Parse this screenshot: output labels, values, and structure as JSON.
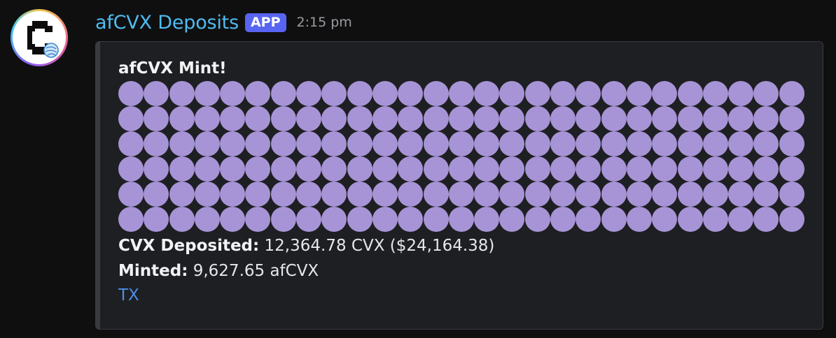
{
  "message": {
    "username": "afCVX Deposits",
    "badge": "APP",
    "timestamp": "2:15 pm",
    "avatar_icon": "clever-c-logo-icon"
  },
  "embed": {
    "title": "afCVX Mint!",
    "dot_count": 162,
    "dot_color": "#a794d6",
    "fields": [
      {
        "label": "CVX Deposited:",
        "value": "12,364.78 CVX ($24,164.38)"
      },
      {
        "label": "Minted:",
        "value": "9,627.65 afCVX"
      }
    ],
    "link_text": "TX"
  },
  "colors": {
    "username": "#4fbbf0",
    "badge_bg": "#5865f2",
    "link": "#4b8fe8",
    "embed_bg": "#1e1f22"
  }
}
